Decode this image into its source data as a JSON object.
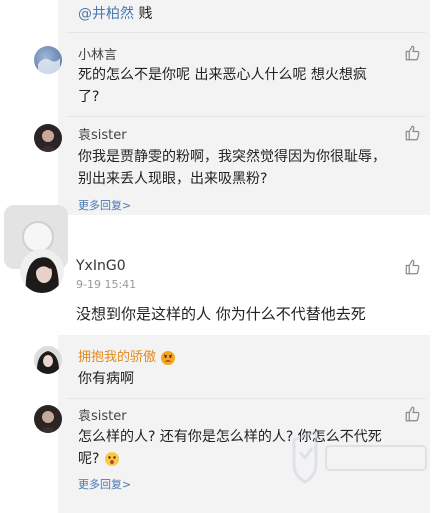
{
  "top_line": {
    "mention": "@井柏然",
    "suffix": " 贱"
  },
  "replies_top": [
    {
      "name": "小林言",
      "text_line1": "死的怎么不是你呢 出来恶心人什么呢 想火想疯",
      "text_line2": "了?"
    },
    {
      "name": "袁sister",
      "text_line1": "你我是贾静雯的粉啊，我突然觉得因为你很耻辱，",
      "text_line2": "别出来丢人现眼，出来吸黑粉?",
      "more": "更多回复>"
    }
  ],
  "main_comment": {
    "name": "YxInG0",
    "time": "9-19 15:41",
    "text": "没想到你是这样的人 你为什么不代替他去死"
  },
  "replies_bottom": [
    {
      "name": "拥抱我的骄傲",
      "emoji": "angry-emoji",
      "text": "你有病啊"
    },
    {
      "name": "袁sister",
      "text_line1": "怎么样的人? 还有你是怎么样的人? 你怎么不代死",
      "text_line2": "呢?",
      "emoji": "shocked-emoji",
      "more": "更多回复>"
    }
  ],
  "icons": {
    "like": "thumbs-up-icon"
  },
  "colors": {
    "link": "#4a78b0",
    "orange_name": "#e28a1f",
    "reply_bg": "#f3f3f3"
  }
}
